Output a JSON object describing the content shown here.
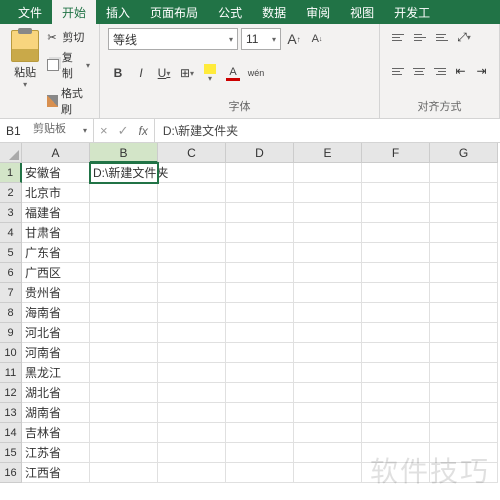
{
  "ribbon": {
    "tabs": [
      "文件",
      "开始",
      "插入",
      "页面布局",
      "公式",
      "数据",
      "审阅",
      "视图",
      "开发工"
    ],
    "active_tab": 1,
    "clipboard": {
      "paste": "粘贴",
      "cut": "剪切",
      "copy": "复制",
      "format_painter": "格式刷",
      "label": "剪贴板"
    },
    "font": {
      "name": "等线",
      "size": "11",
      "grow": "A",
      "shrink": "A",
      "bold": "B",
      "italic": "I",
      "underline": "U",
      "wen": "wén",
      "label": "字体"
    },
    "alignment": {
      "label": "对齐方式"
    }
  },
  "namebox": {
    "cell_ref": "B1",
    "cancel": "×",
    "confirm": "✓",
    "fx": "fx",
    "formula": "D:\\新建文件夹"
  },
  "columns": [
    "A",
    "B",
    "C",
    "D",
    "E",
    "F",
    "G"
  ],
  "active_col": 1,
  "active_row": 0,
  "rows": [
    {
      "n": "1",
      "cells": [
        "安徽省",
        "D:\\新建文件夹",
        "",
        "",
        "",
        "",
        ""
      ]
    },
    {
      "n": "2",
      "cells": [
        "北京市",
        "",
        "",
        "",
        "",
        "",
        ""
      ]
    },
    {
      "n": "3",
      "cells": [
        "福建省",
        "",
        "",
        "",
        "",
        "",
        ""
      ]
    },
    {
      "n": "4",
      "cells": [
        "甘肃省",
        "",
        "",
        "",
        "",
        "",
        ""
      ]
    },
    {
      "n": "5",
      "cells": [
        "广东省",
        "",
        "",
        "",
        "",
        "",
        ""
      ]
    },
    {
      "n": "6",
      "cells": [
        "广西区",
        "",
        "",
        "",
        "",
        "",
        ""
      ]
    },
    {
      "n": "7",
      "cells": [
        "贵州省",
        "",
        "",
        "",
        "",
        "",
        ""
      ]
    },
    {
      "n": "8",
      "cells": [
        "海南省",
        "",
        "",
        "",
        "",
        "",
        ""
      ]
    },
    {
      "n": "9",
      "cells": [
        "河北省",
        "",
        "",
        "",
        "",
        "",
        ""
      ]
    },
    {
      "n": "10",
      "cells": [
        "河南省",
        "",
        "",
        "",
        "",
        "",
        ""
      ]
    },
    {
      "n": "11",
      "cells": [
        "黑龙江",
        "",
        "",
        "",
        "",
        "",
        ""
      ]
    },
    {
      "n": "12",
      "cells": [
        "湖北省",
        "",
        "",
        "",
        "",
        "",
        ""
      ]
    },
    {
      "n": "13",
      "cells": [
        "湖南省",
        "",
        "",
        "",
        "",
        "",
        ""
      ]
    },
    {
      "n": "14",
      "cells": [
        "吉林省",
        "",
        "",
        "",
        "",
        "",
        ""
      ]
    },
    {
      "n": "15",
      "cells": [
        "江苏省",
        "",
        "",
        "",
        "",
        "",
        ""
      ]
    },
    {
      "n": "16",
      "cells": [
        "江西省",
        "",
        "",
        "",
        "",
        "",
        ""
      ]
    }
  ],
  "watermark": "软件技巧"
}
